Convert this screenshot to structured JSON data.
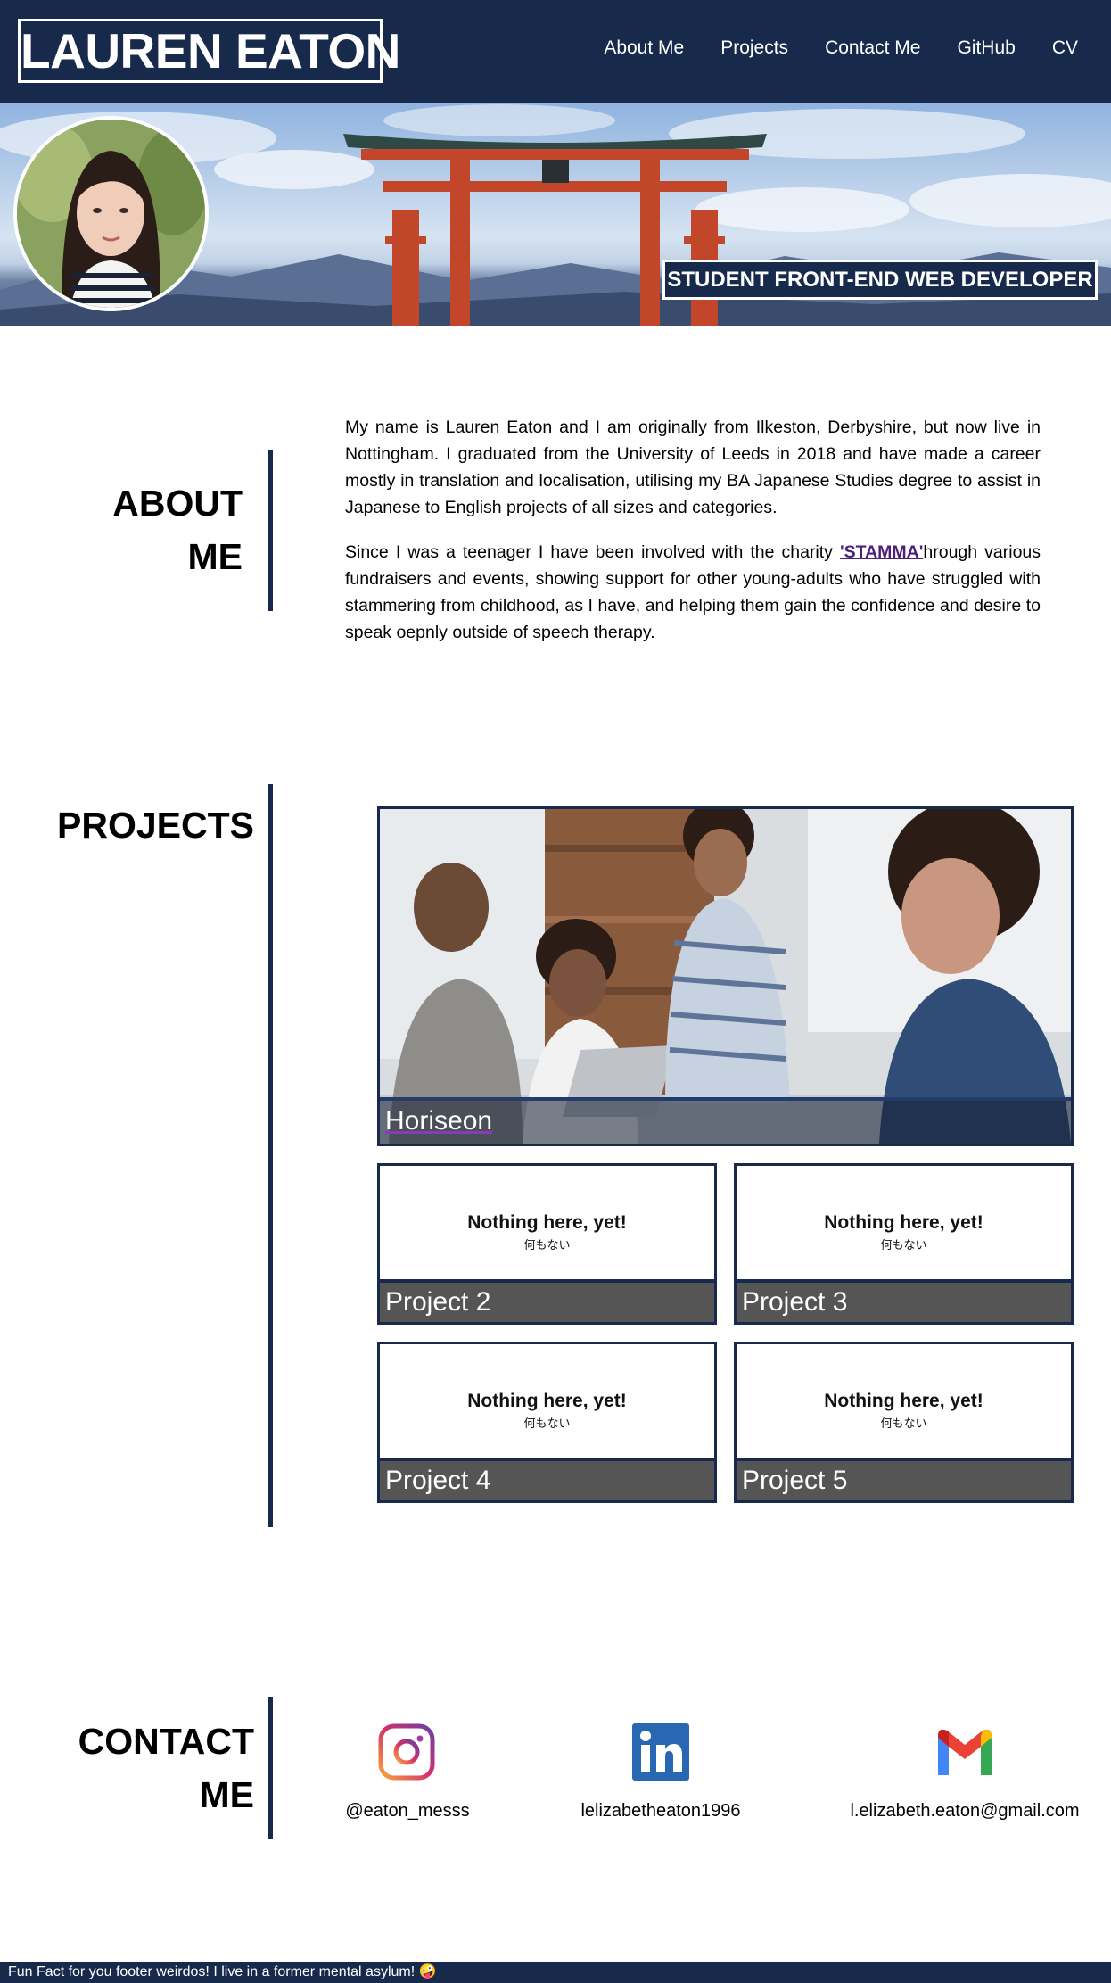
{
  "header": {
    "logo": "LAUREN EATON",
    "nav": [
      "About Me",
      "Projects",
      "Contact Me",
      "GitHub",
      "CV"
    ]
  },
  "hero": {
    "tagline": "STUDENT FRONT-END WEB DEVELOPER"
  },
  "about": {
    "title": "ABOUT ME",
    "paragraph1": "My name is Lauren Eaton and I am originally from Ilkeston, Derbyshire, but now live in Nottingham. I graduated from the University of Leeds in 2018 and have made a career mostly in translation and localisation, utilising my BA Japanese Studies degree to assist in Japanese to English projects of all sizes and categories.",
    "paragraph2_before": "Since I was a teenager I have been involved with the charity ",
    "paragraph2_link": "'STAMMA'",
    "paragraph2_after": "hrough various fundraisers and events, showing support for other young-adults who have struggled with stammering from childhood, as I have, and helping them gain the confidence and desire to speak oepnly outside of speech therapy."
  },
  "projects": {
    "title": "PROJECTS",
    "featured": {
      "label": "Horiseon"
    },
    "placeholder_title": "Nothing here, yet!",
    "placeholder_sub": "何もない",
    "items": [
      {
        "label": "Project 2"
      },
      {
        "label": "Project 3"
      },
      {
        "label": "Project 4"
      },
      {
        "label": "Project 5"
      }
    ]
  },
  "contact": {
    "title": "CONTACT ME",
    "items": [
      {
        "icon": "instagram-icon",
        "label": "@eaton_messs"
      },
      {
        "icon": "linkedin-icon",
        "label": "lelizabetheaton1996"
      },
      {
        "icon": "gmail-icon",
        "label": "l.elizabeth.eaton@gmail.com"
      }
    ]
  },
  "footer": {
    "text": "Fun Fact for you footer weirdos! I live in a former mental asylum! 🤪"
  },
  "colors": {
    "navy": "#172a4c",
    "caption_grey": "#555555",
    "link_purple": "#4b1f7c"
  }
}
